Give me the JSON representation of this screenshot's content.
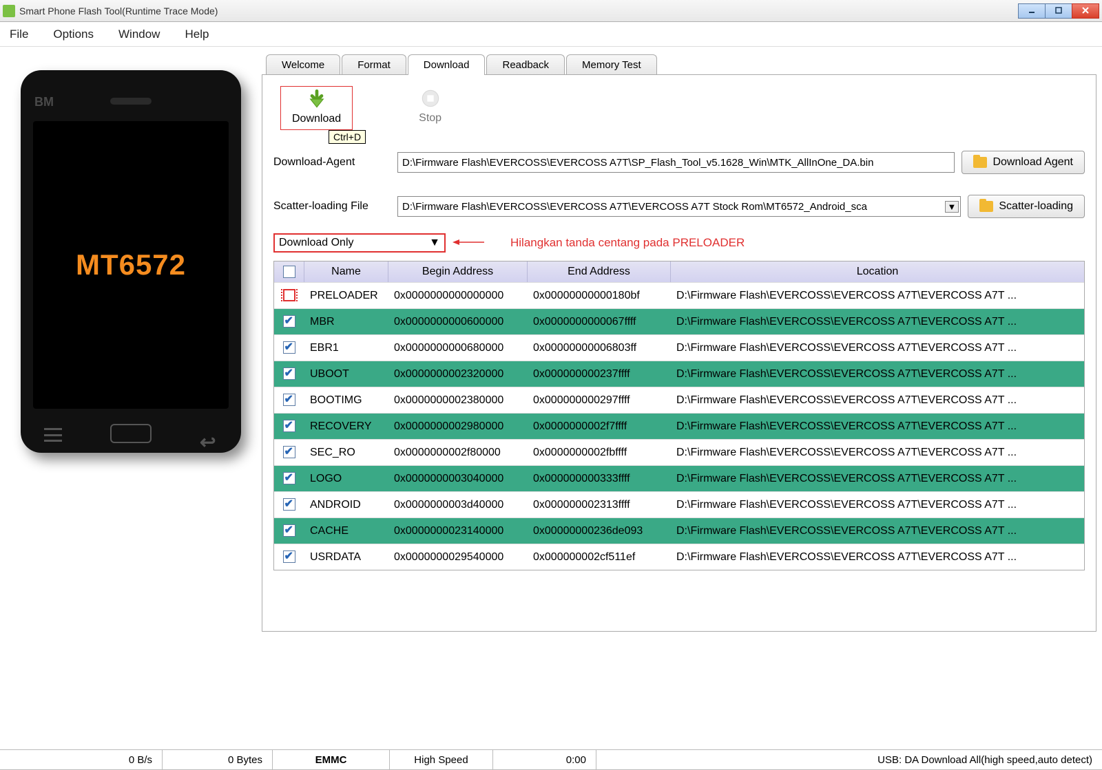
{
  "window": {
    "title": "Smart Phone Flash Tool(Runtime Trace Mode)"
  },
  "menu": {
    "file": "File",
    "options": "Options",
    "window": "Window",
    "help": "Help"
  },
  "phone": {
    "brand": "BM",
    "chip": "MT6572"
  },
  "tabs": {
    "welcome": "Welcome",
    "format": "Format",
    "download": "Download",
    "readback": "Readback",
    "memtest": "Memory Test"
  },
  "toolbar": {
    "download_label": "Download",
    "stop_label": "Stop",
    "tooltip": "Ctrl+D"
  },
  "form": {
    "da_label": "Download-Agent",
    "da_value": "D:\\Firmware Flash\\EVERCOSS\\EVERCOSS A7T\\SP_Flash_Tool_v5.1628_Win\\MTK_AllInOne_DA.bin",
    "da_button": "Download Agent",
    "scatter_label": "Scatter-loading File",
    "scatter_value": "D:\\Firmware Flash\\EVERCOSS\\EVERCOSS A7T\\EVERCOSS A7T Stock Rom\\MT6572_Android_sca",
    "scatter_button": "Scatter-loading"
  },
  "mode": {
    "selected": "Download Only"
  },
  "annotation": "Hilangkan tanda centang pada PRELOADER",
  "table": {
    "headers": {
      "name": "Name",
      "begin": "Begin Address",
      "end": "End Address",
      "location": "Location"
    },
    "rows": [
      {
        "checked": false,
        "highlighted": false,
        "name": "PRELOADER",
        "begin": "0x0000000000000000",
        "end": "0x00000000000180bf",
        "location": "D:\\Firmware Flash\\EVERCOSS\\EVERCOSS A7T\\EVERCOSS A7T ..."
      },
      {
        "checked": true,
        "highlighted": true,
        "name": "MBR",
        "begin": "0x0000000000600000",
        "end": "0x0000000000067ffff",
        "location": "D:\\Firmware Flash\\EVERCOSS\\EVERCOSS A7T\\EVERCOSS A7T ..."
      },
      {
        "checked": true,
        "highlighted": false,
        "name": "EBR1",
        "begin": "0x0000000000680000",
        "end": "0x00000000006803ff",
        "location": "D:\\Firmware Flash\\EVERCOSS\\EVERCOSS A7T\\EVERCOSS A7T ..."
      },
      {
        "checked": true,
        "highlighted": true,
        "name": "UBOOT",
        "begin": "0x0000000002320000",
        "end": "0x000000000237ffff",
        "location": "D:\\Firmware Flash\\EVERCOSS\\EVERCOSS A7T\\EVERCOSS A7T ..."
      },
      {
        "checked": true,
        "highlighted": false,
        "name": "BOOTIMG",
        "begin": "0x0000000002380000",
        "end": "0x000000000297ffff",
        "location": "D:\\Firmware Flash\\EVERCOSS\\EVERCOSS A7T\\EVERCOSS A7T ..."
      },
      {
        "checked": true,
        "highlighted": true,
        "name": "RECOVERY",
        "begin": "0x0000000002980000",
        "end": "0x0000000002f7ffff",
        "location": "D:\\Firmware Flash\\EVERCOSS\\EVERCOSS A7T\\EVERCOSS A7T ..."
      },
      {
        "checked": true,
        "highlighted": false,
        "name": "SEC_RO",
        "begin": "0x0000000002f80000",
        "end": "0x0000000002fbffff",
        "location": "D:\\Firmware Flash\\EVERCOSS\\EVERCOSS A7T\\EVERCOSS A7T ..."
      },
      {
        "checked": true,
        "highlighted": true,
        "name": "LOGO",
        "begin": "0x0000000003040000",
        "end": "0x000000000333ffff",
        "location": "D:\\Firmware Flash\\EVERCOSS\\EVERCOSS A7T\\EVERCOSS A7T ..."
      },
      {
        "checked": true,
        "highlighted": false,
        "name": "ANDROID",
        "begin": "0x0000000003d40000",
        "end": "0x000000002313ffff",
        "location": "D:\\Firmware Flash\\EVERCOSS\\EVERCOSS A7T\\EVERCOSS A7T ..."
      },
      {
        "checked": true,
        "highlighted": true,
        "name": "CACHE",
        "begin": "0x0000000023140000",
        "end": "0x00000000236de093",
        "location": "D:\\Firmware Flash\\EVERCOSS\\EVERCOSS A7T\\EVERCOSS A7T ..."
      },
      {
        "checked": true,
        "highlighted": false,
        "name": "USRDATA",
        "begin": "0x0000000029540000",
        "end": "0x000000002cf511ef",
        "location": "D:\\Firmware Flash\\EVERCOSS\\EVERCOSS A7T\\EVERCOSS A7T ..."
      }
    ]
  },
  "status": {
    "speed": "0 B/s",
    "bytes": "0 Bytes",
    "storage": "EMMC",
    "link": "High Speed",
    "time": "0:00",
    "mode": "USB: DA Download All(high speed,auto detect)"
  }
}
